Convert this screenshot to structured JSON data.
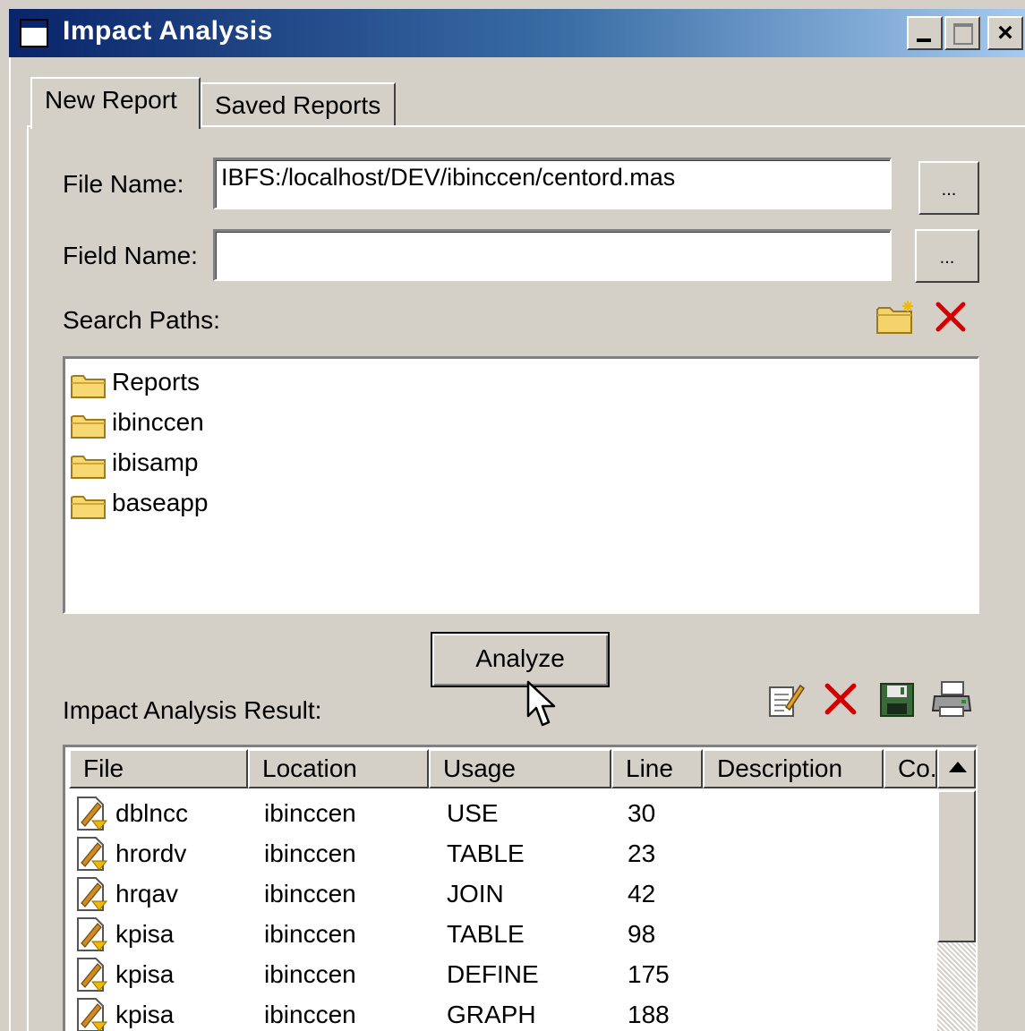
{
  "window": {
    "title": "Impact Analysis",
    "controls": {
      "minimize": "_",
      "maximize": "□",
      "close": "×"
    }
  },
  "tabs": [
    {
      "label": "New Report",
      "active": true
    },
    {
      "label": "Saved Reports",
      "active": false
    }
  ],
  "form": {
    "file_name_label": "File Name:",
    "file_name_value": "IBFS:/localhost/DEV/ibinccen/centord.mas",
    "file_browse_label": "...",
    "field_name_label": "Field Name:",
    "field_name_value": "",
    "field_browse_label": "...",
    "search_paths_label": "Search Paths:",
    "search_paths": [
      "Reports",
      "ibinccen",
      "ibisamp",
      "baseapp"
    ],
    "analyze_label": "Analyze"
  },
  "results": {
    "label": "Impact Analysis Result:",
    "columns": [
      "File",
      "Location",
      "Usage",
      "Line",
      "Description",
      "Co."
    ],
    "rows": [
      {
        "file": "dblncc",
        "location": "ibinccen",
        "usage": "USE",
        "line": "30"
      },
      {
        "file": "hrordv",
        "location": "ibinccen",
        "usage": "TABLE",
        "line": "23"
      },
      {
        "file": "hrqav",
        "location": "ibinccen",
        "usage": "JOIN",
        "line": "42"
      },
      {
        "file": "kpisa",
        "location": "ibinccen",
        "usage": "TABLE",
        "line": "98"
      },
      {
        "file": "kpisa",
        "location": "ibinccen",
        "usage": "DEFINE",
        "line": "175"
      },
      {
        "file": "kpisa",
        "location": "ibinccen",
        "usage": "GRAPH",
        "line": "188"
      }
    ]
  },
  "icons": {
    "search_path_toolbar": [
      "new-folder-icon",
      "delete-icon"
    ],
    "result_toolbar": [
      "edit-icon",
      "delete-icon",
      "save-icon",
      "print-icon"
    ]
  },
  "colors": {
    "titlebar_start": "#0a246a",
    "titlebar_end": "#a6caf0",
    "face": "#d4d0c8",
    "delete_red": "#d40000"
  }
}
